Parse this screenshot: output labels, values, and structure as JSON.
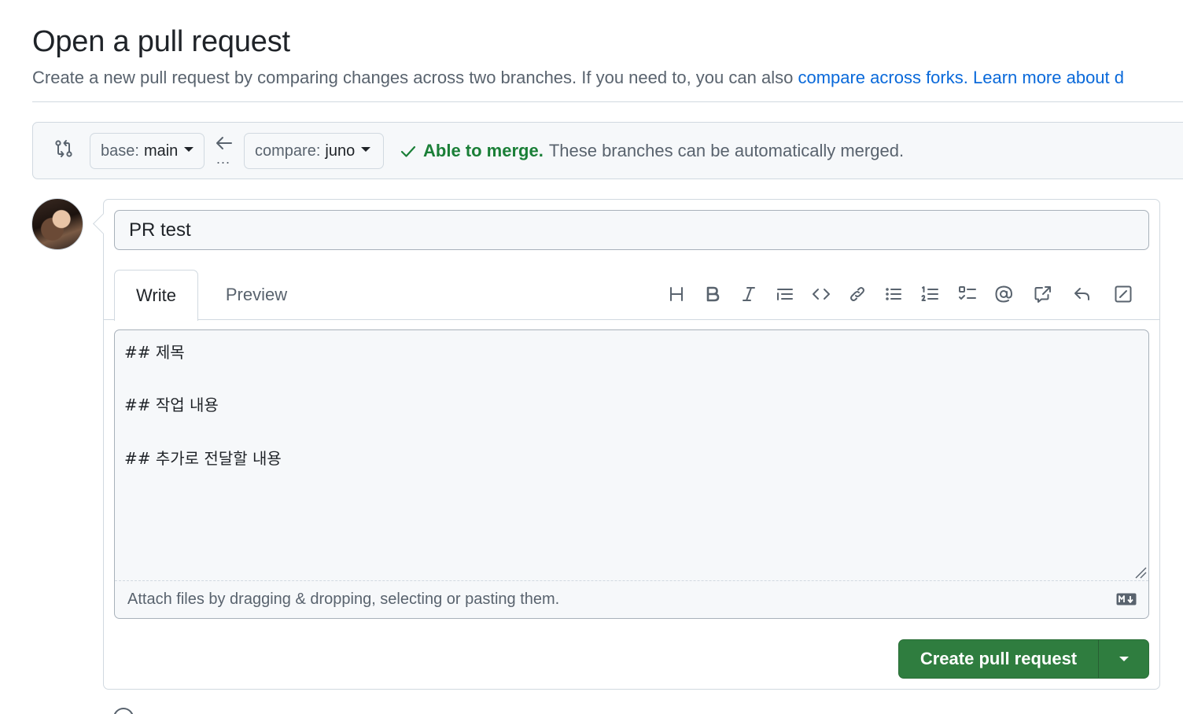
{
  "header": {
    "title": "Open a pull request",
    "subtitle_text": "Create a new pull request by comparing changes across two branches. If you need to, you can also ",
    "compare_forks_link": "compare across forks.",
    "learn_more_link": "Learn more about d"
  },
  "compare_bar": {
    "base_prefix": "base:",
    "base_branch": "main",
    "compare_prefix": "compare:",
    "compare_branch": "juno",
    "dots": "...",
    "merge_ok": "Able to merge.",
    "merge_text": "These branches can be automatically merged."
  },
  "form": {
    "title_value": "PR test",
    "tabs": [
      {
        "label": "Write"
      },
      {
        "label": "Preview"
      }
    ],
    "toolbar_icons": [
      "heading-icon",
      "bold-icon",
      "italic-icon",
      "quote-icon",
      "code-icon",
      "link-icon",
      "unordered-list-icon",
      "ordered-list-icon",
      "task-list-icon",
      "mention-icon",
      "cross-reference-icon",
      "saved-replies-icon",
      "slash-commands-icon"
    ],
    "body_value": "## 제목\n\n## 작업 내용\n\n## 추가로 전달할 내용",
    "attach_hint": "Attach files by dragging & dropping, selecting or pasting them.",
    "submit_label": "Create pull request"
  },
  "colors": {
    "accent_link": "#0969da",
    "success": "#1a7f37",
    "primary_button": "#2f7d3f"
  }
}
